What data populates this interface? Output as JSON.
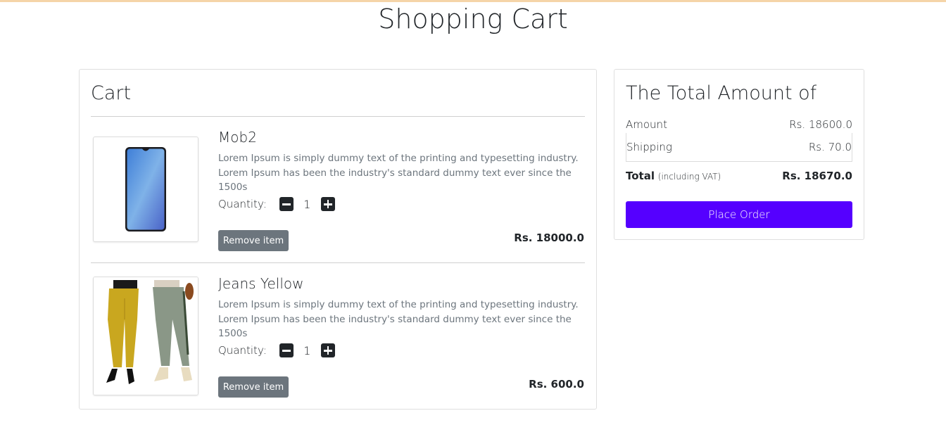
{
  "page": {
    "title": "Shopping Cart"
  },
  "cart": {
    "heading": "Cart",
    "quantity_label": "Quantity:",
    "remove_label": "Remove item",
    "items": [
      {
        "name": "Mob2",
        "description": "Lorem Ipsum is simply dummy text of the printing and typesetting industry. Lorem Ipsum has been the industry's standard dummy text ever since the 1500s",
        "quantity": "1",
        "price": "Rs. 18000.0",
        "image": "smartphone-image"
      },
      {
        "name": "Jeans Yellow",
        "description": "Lorem Ipsum is simply dummy text of the printing and typesetting industry. Lorem Ipsum has been the industry's standard dummy text ever since the 1500s",
        "quantity": "1",
        "price": "Rs. 600.0",
        "image": "jeans-image"
      }
    ]
  },
  "summary": {
    "heading": "The Total Amount of",
    "amount_label": "Amount",
    "amount_value": "Rs. 18600.0",
    "shipping_label": "Shipping",
    "shipping_value": "Rs. 70.0",
    "total_label": "Total",
    "total_note": "(including VAT)",
    "total_value": "Rs. 18670.0",
    "place_order_label": "Place Order"
  },
  "colors": {
    "accent": "#5500ff",
    "secondary": "#6c757d",
    "dark": "#212529"
  }
}
